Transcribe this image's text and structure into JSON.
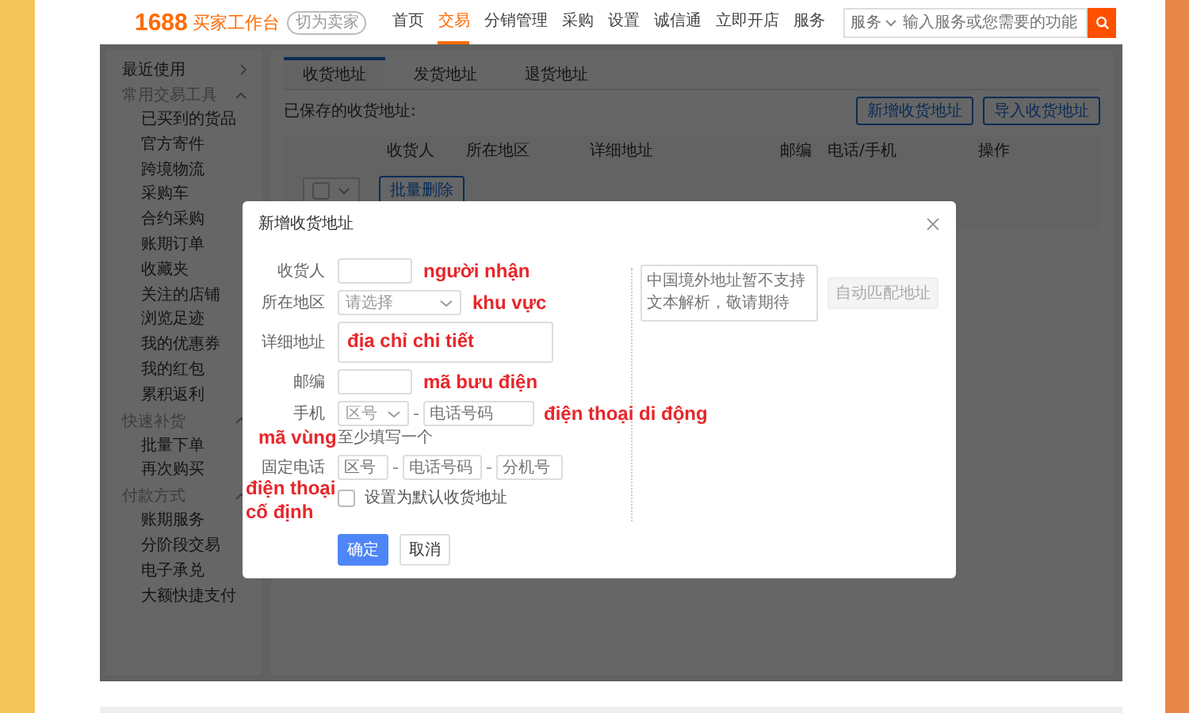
{
  "header": {
    "logo": "1688",
    "title": "买家工作台",
    "switch_button": "切为卖家",
    "nav": [
      {
        "label": "首页",
        "selected": false
      },
      {
        "label": "交易",
        "selected": true
      },
      {
        "label": "分销管理",
        "selected": false
      },
      {
        "label": "采购",
        "selected": false
      },
      {
        "label": "设置",
        "selected": false
      },
      {
        "label": "诚信通",
        "selected": false
      },
      {
        "label": "立即开店",
        "selected": false
      },
      {
        "label": "服务",
        "selected": false
      }
    ],
    "search": {
      "scope": "服务",
      "placeholder": "输入服务或您需要的功能"
    }
  },
  "sidebar": {
    "sections": [
      {
        "title": "最近使用",
        "kind": "link"
      },
      {
        "title": "常用交易工具",
        "kind": "group",
        "expanded": true,
        "items": [
          "已买到的货品",
          "官方寄件",
          "跨境物流",
          "采购车",
          "合约采购",
          "账期订单",
          "收藏夹",
          "关注的店铺",
          "浏览足迹",
          "我的优惠券",
          "我的红包",
          "累积返利"
        ]
      },
      {
        "title": "快速补货",
        "kind": "group",
        "expanded": true,
        "items": [
          "批量下单",
          "再次购买"
        ]
      },
      {
        "title": "付款方式",
        "kind": "group",
        "expanded": true,
        "items": [
          "账期服务",
          "分阶段交易",
          "电子承兑",
          "大额快捷支付"
        ]
      }
    ]
  },
  "tabs": [
    {
      "label": "收货地址",
      "selected": true
    },
    {
      "label": "发货地址",
      "selected": false
    },
    {
      "label": "退货地址",
      "selected": false
    }
  ],
  "saved_label": "已保存的收货地址:",
  "actions": [
    "新增收货地址",
    "导入收货地址"
  ],
  "table": {
    "columns": [
      "收货人",
      "所在地区",
      "详细地址",
      "邮编",
      "电话/手机",
      "操作"
    ]
  },
  "bulk": {
    "select_checked": false,
    "delete_button": "批量删除"
  },
  "dialog": {
    "title": "新增收货地址",
    "fields": [
      {
        "kind": "input",
        "label": "收货人",
        "annotation": "người nhận"
      },
      {
        "kind": "select",
        "label": "所在地区",
        "placeholder": "请选择",
        "annotation": "khu vực"
      },
      {
        "kind": "textarea",
        "label": "详细地址",
        "annotation": "địa chỉ chi tiết"
      },
      {
        "kind": "input",
        "label": "邮编",
        "annotation": "mã bưu điện"
      },
      {
        "kind": "mobile",
        "label": "手机",
        "placeholders": [
          "区号",
          "电话号码"
        ],
        "annotation": "điện thoại di động",
        "hint": "至少填写一个",
        "hint_annotation": "mã vùng"
      },
      {
        "kind": "landline",
        "label": "固定电话",
        "placeholders": [
          "区号",
          "电话号码",
          "分机号"
        ],
        "annotation": "điện thoại cố định"
      }
    ],
    "default_checkbox": {
      "label": "设置为默认收货地址",
      "checked": false
    },
    "buttons": [
      {
        "label": "确定",
        "kind": "primary"
      },
      {
        "label": "取消",
        "kind": "default"
      }
    ],
    "paste_box": {
      "placeholder": "中国境外地址暂不支持文本解析，敬请期待"
    },
    "match_button": {
      "label": "自动匹配地址",
      "disabled": true
    }
  }
}
